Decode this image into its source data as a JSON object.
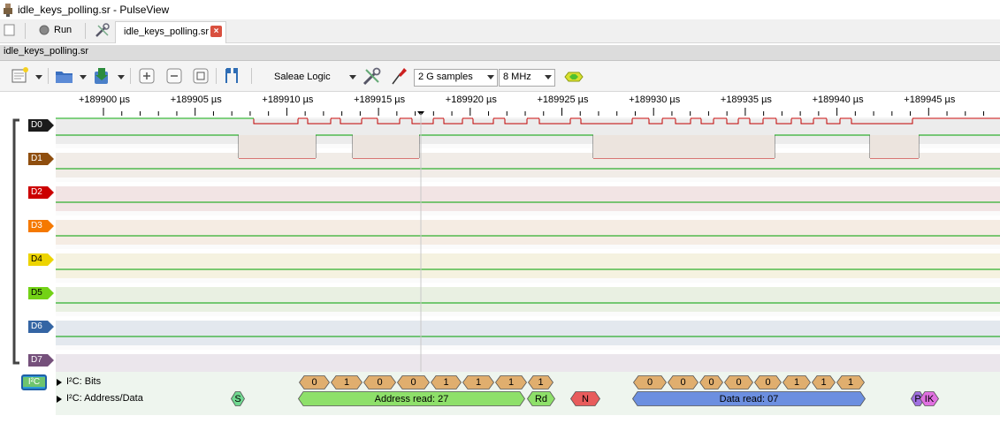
{
  "window": {
    "title": "idle_keys_polling.sr - PulseView"
  },
  "toolbar": {
    "run_label": "Run"
  },
  "tabs": [
    {
      "label": "idle_keys_polling.sr",
      "close": "×"
    }
  ],
  "session": {
    "title": "idle_keys_polling.sr"
  },
  "device": {
    "name": "Saleae Logic",
    "samples": "2 G samples",
    "samplerate": "8 MHz"
  },
  "ruler": {
    "ticks": [
      "+189900 µs",
      "+189905 µs",
      "+189910 µs",
      "+189915 µs",
      "+189920 µs",
      "+189925 µs",
      "+189930 µs",
      "+189935 µs",
      "+189940 µs",
      "+189945 µs"
    ]
  },
  "channels": [
    {
      "name": "D0",
      "color": "#1b1b1b",
      "bg": "#ececec"
    },
    {
      "name": "D1",
      "color": "#8f4e0e",
      "bg": "#f1ece7"
    },
    {
      "name": "D2",
      "color": "#cc0000",
      "bg": "#f2e4e4"
    },
    {
      "name": "D3",
      "color": "#f57900",
      "bg": "#f5ece3"
    },
    {
      "name": "D4",
      "color": "#edd400",
      "bg": "#f5f2e0"
    },
    {
      "name": "D5",
      "color": "#73d216",
      "bg": "#e9f0e2"
    },
    {
      "name": "D6",
      "color": "#3465a4",
      "bg": "#e3e8ee"
    },
    {
      "name": "D7",
      "color": "#75507b",
      "bg": "#ebe6ec"
    }
  ],
  "decoder": {
    "badge": "I²C",
    "rows": [
      {
        "label": "I²C: Bits"
      },
      {
        "label": "I²C: Address/Data"
      }
    ],
    "bits": [
      "0",
      "1",
      "0",
      "0",
      "1",
      "1",
      "1",
      "1",
      "0",
      "0",
      "0",
      "0",
      "0",
      "1",
      "1",
      "1"
    ],
    "annotations": {
      "start": "S",
      "address": "Address read: 27",
      "rw": "Rd",
      "nack": "N",
      "data": "Data read: 07",
      "stop": "P",
      "ack": "IK"
    }
  },
  "colors": {
    "trace_high": "#00a000",
    "trace_low": "#c00000",
    "bits_fill": "#e0ae6e",
    "address_fill": "#8ee06a",
    "nack_fill": "#e85c5c",
    "data_fill": "#6c8fe0",
    "stop_fill": "#a070e0",
    "ack_fill": "#e070e0",
    "start_fill": "#70d890",
    "badge": "#2a9bd8"
  }
}
